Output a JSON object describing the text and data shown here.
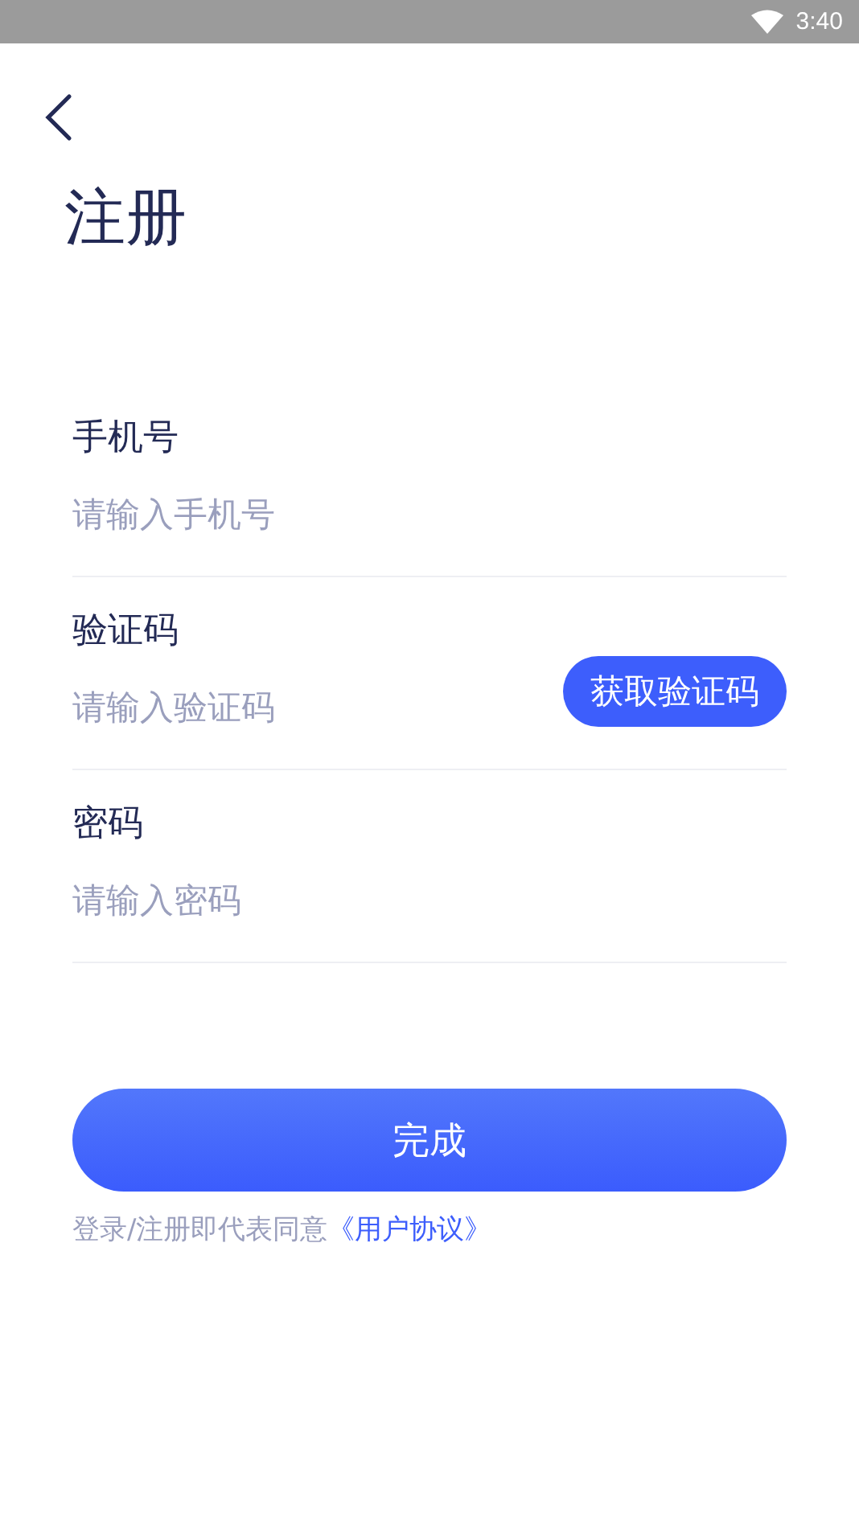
{
  "status_bar": {
    "time": "3:40"
  },
  "title": "注册",
  "fields": [
    {
      "kind": "text",
      "label": "手机号",
      "placeholder": "请输入手机号"
    },
    {
      "kind": "code",
      "label": "验证码",
      "placeholder": "请输入验证码",
      "action": "获取验证码"
    },
    {
      "kind": "password",
      "label": "密码",
      "placeholder": "请输入密码"
    }
  ],
  "submit": "完成",
  "agreement": {
    "text": "登录/注册即代表同意",
    "link": "《用户协议》"
  }
}
